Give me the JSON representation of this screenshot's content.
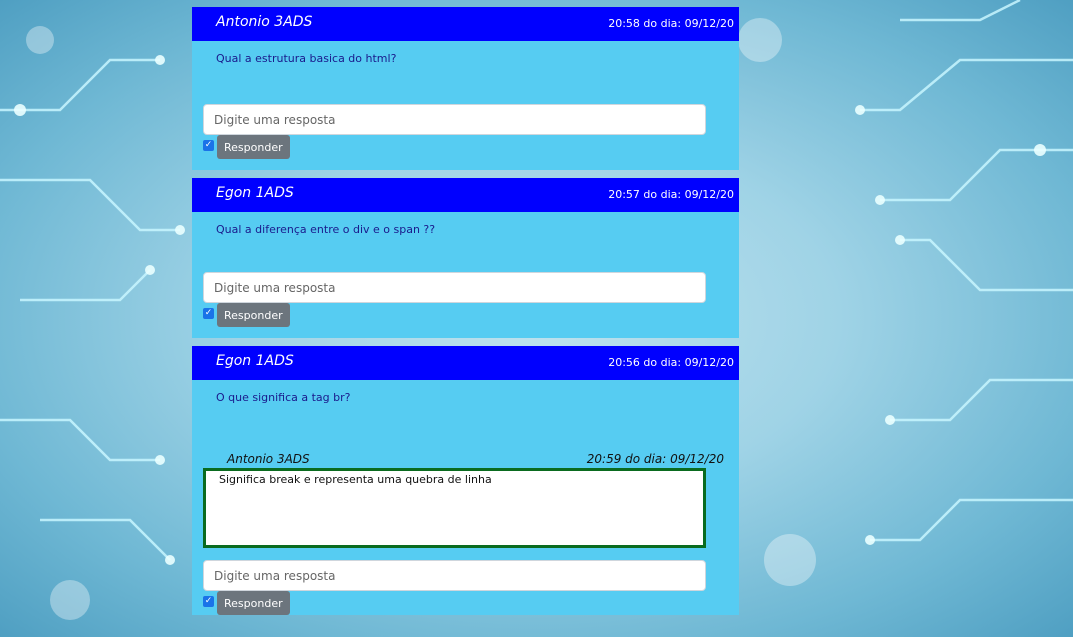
{
  "posts": [
    {
      "author": "Antonio 3ADS",
      "time": "20:58 do dia: 09/12/20",
      "question": "Qual a estrutura basica do html?",
      "answers": [],
      "reply_placeholder": "Digite uma resposta",
      "reply_button": "Responder"
    },
    {
      "author": "Egon 1ADS",
      "time": "20:57 do dia: 09/12/20",
      "question": "Qual a diferença entre o div e o span ??",
      "answers": [],
      "reply_placeholder": "Digite uma resposta",
      "reply_button": "Responder"
    },
    {
      "author": "Egon 1ADS",
      "time": "20:56 do dia: 09/12/20",
      "question": "O que significa a tag br?",
      "answers": [
        {
          "author": "Antonio 3ADS",
          "time": "20:59 do dia: 09/12/20",
          "text": "Significa break e representa uma quebra de linha"
        }
      ],
      "reply_placeholder": "Digite uma resposta",
      "reply_button": "Responder"
    }
  ],
  "colors": {
    "header": "#0000ff",
    "card": "#56ccf2",
    "answer_border": "#0a6b1f",
    "button": "#6c757d"
  },
  "icons": {
    "checkbox": "checkbox-checked-icon"
  }
}
